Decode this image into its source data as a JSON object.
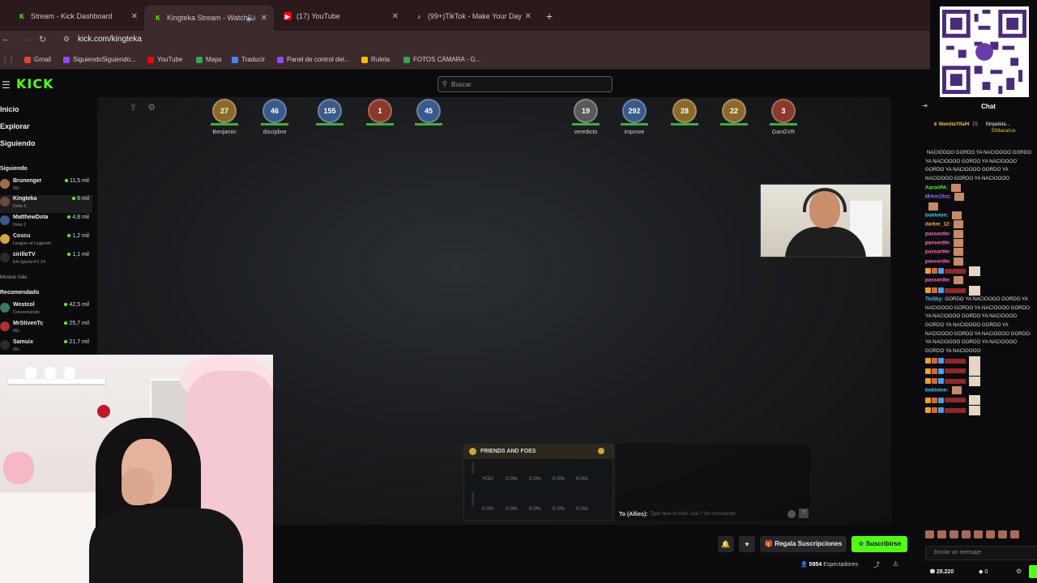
{
  "browser": {
    "tabs": [
      {
        "title": "Stream - Kick Dashboard",
        "favicon": "kick-icon",
        "color": "#53fc18"
      },
      {
        "title": "Kingteka Stream - Watch Li",
        "favicon": "kick-icon",
        "color": "#53fc18",
        "active": true
      },
      {
        "title": "(17) YouTube",
        "favicon": "youtube-icon",
        "color": "#ff0000"
      },
      {
        "title": "(99+)TikTok - Make Your Day",
        "favicon": "tiktok-icon",
        "color": "#ffffff"
      }
    ],
    "url": "kick.com/kingteka",
    "bookmarks": [
      {
        "label": "Gmail",
        "color": "#ea4335"
      },
      {
        "label": "SiguiendoSiguiendo...",
        "color": "#9146ff"
      },
      {
        "label": "YouTube",
        "color": "#ff0000"
      },
      {
        "label": "Maps",
        "color": "#34a853"
      },
      {
        "label": "Traducir",
        "color": "#4285f4"
      },
      {
        "label": "Panel de control del...",
        "color": "#9146ff"
      },
      {
        "label": "Ruleta",
        "color": "#fbbc05"
      },
      {
        "label": "FOTOS CÁMARA - G...",
        "color": "#34a853"
      }
    ]
  },
  "header": {
    "logo": "KICK",
    "search_placeholder": "Buscar"
  },
  "sidebar": {
    "nav": [
      "Inicio",
      "Explorar",
      "Siguiendo"
    ],
    "following_title": "Siguiendo",
    "following": [
      {
        "name": "Brunenger",
        "category": "IRL",
        "viewers": "11,5 mil",
        "color": "#a06b4a"
      },
      {
        "name": "Kingteka",
        "category": "Dota 2",
        "viewers": "6 mil",
        "color": "#6b4a3a",
        "selected": true
      },
      {
        "name": "MatthewDota",
        "category": "Dota 2",
        "viewers": "4,8 mil",
        "color": "#3a5a8a"
      },
      {
        "name": "Coscu",
        "category": "League of Legends",
        "viewers": "1,2 mil",
        "color": "#d4a64a"
      },
      {
        "name": "cirilloTV",
        "category": "EA Sports F1 24",
        "viewers": "1,1 mil",
        "color": "#2a2a2a"
      }
    ],
    "show_more": "Mostrar más",
    "recommended_title": "Recomendado",
    "recommended": [
      {
        "name": "Westcol",
        "category": "Conversando",
        "viewers": "42,5 mil",
        "color": "#3a7a5a"
      },
      {
        "name": "MrStivenTc",
        "category": "IRL",
        "viewers": "25,7 mil",
        "color": "#b03030"
      },
      {
        "name": "Samuix",
        "category": "IRL",
        "viewers": "21,7 mil",
        "color": "#2a2a2a"
      }
    ]
  },
  "game": {
    "radiant": [
      {
        "level": "27",
        "player": "Benjamin",
        "color": "#8a6a2a"
      },
      {
        "level": "46",
        "player": "discipline",
        "color": "#3a5a8a"
      },
      {
        "level": "155",
        "player": "",
        "color": "#3a5a8a"
      },
      {
        "level": "1",
        "player": "",
        "color": "#8a3a2a"
      },
      {
        "level": "45",
        "player": "",
        "color": "#3a5a8a"
      }
    ],
    "dire": [
      {
        "level": "19",
        "player": "veredicto",
        "color": "#5a5a5a"
      },
      {
        "level": "292",
        "player": "improve",
        "color": "#3a5a8a"
      },
      {
        "level": "28",
        "player": "",
        "color": "#8a6a2a"
      },
      {
        "level": "22",
        "player": "",
        "color": "#8a6a2a"
      },
      {
        "level": "3",
        "player": "GanGVR",
        "color": "#8a3a2a"
      }
    ],
    "friends_foes": {
      "title": "FRIENDS AND FOES",
      "allies_label": "ALLIES",
      "enemies_label": "ENEMIES",
      "you_label": "YOU",
      "allies_values": [
        "0.0%",
        "0.0%",
        "0.0%",
        "0.0%"
      ],
      "enemies_values": [
        "0.0%",
        "0.0%",
        "0.0%",
        "0.0%",
        "0.0%"
      ]
    },
    "ally_chat": {
      "label": "To (Allies):",
      "placeholder": "Type here to chat. Use '/' for commands."
    }
  },
  "player_controls": {
    "gift_label": "Regala Suscripciones",
    "subscribe_label": "Suscribirse",
    "viewers_count": "5954",
    "viewers_label": "Espectadores"
  },
  "chat": {
    "title": "Chat",
    "pinned": [
      {
        "user": "MamitaYifalH",
        "amount": "25"
      },
      {
        "user": "Ninjadela...",
        "amount": ""
      },
      {
        "user": "ElMacarius",
        "amount": ""
      }
    ],
    "messages": [
      {
        "user": "",
        "text": "NACIOOOO GORDO YA NACIOOOO GORDO YA NACIOOOO GORDO YA NACIOOOO GORDO YA NACIOOOO GORDO YA NACIOOOO GORDO YA NACIOOOO",
        "color": "#ffffff",
        "emotes": 0
      },
      {
        "user": "AaronPA:",
        "text": "",
        "color": "#53fc18",
        "emotes": 1
      },
      {
        "user": "Mrkm10xz:",
        "text": "",
        "color": "#a070ff",
        "emotes": 1
      },
      {
        "user": "",
        "text": "",
        "color": "#ff4040",
        "emotes": 1
      },
      {
        "user": "bobloton:",
        "text": "",
        "color": "#40d0ff",
        "emotes": 1
      },
      {
        "user": "darker_12:",
        "text": "",
        "color": "#ffb040",
        "emotes": 1
      },
      {
        "user": "passordie:",
        "text": "",
        "color": "#ff70c0",
        "emotes": 1
      },
      {
        "user": "passordie:",
        "text": "",
        "color": "#ff70c0",
        "emotes": 1
      },
      {
        "user": "passordie:",
        "text": "",
        "color": "#ff70c0",
        "emotes": 1
      },
      {
        "user": "passordie:",
        "text": "",
        "color": "#ff70c0",
        "emotes": 1
      },
      {
        "user": "",
        "text": "",
        "color": "#ff4040",
        "emotes": 2
      },
      {
        "user": "passordie:",
        "text": "",
        "color": "#ff70c0",
        "emotes": 1
      },
      {
        "user": "",
        "text": "",
        "color": "#ff4040",
        "emotes": 2
      },
      {
        "user": "TioSky:",
        "text": "GORDO YA NACIOOOO GORDO YA NACIOOOO GORDO YA NACIOOOO GORDO YA NACIOOOO GORDO YA NACIOOOO GORDO YA NACIOOOO GORDO YA NACIOOOO GORDO YA NACIOOOO GORDO YA NACIOOOO GORDO YA NACIOOOO GORDO YA NACIOOOO",
        "color": "#40d0ff",
        "emotes": 0
      },
      {
        "user": "",
        "text": "",
        "color": "#ff4040",
        "emotes": 2
      },
      {
        "user": "",
        "text": "",
        "color": "#ff4040",
        "emotes": 2
      },
      {
        "user": "",
        "text": "",
        "color": "#ff4040",
        "emotes": 2
      },
      {
        "user": "bobloton:",
        "text": "",
        "color": "#40d0ff",
        "emotes": 1
      },
      {
        "user": "",
        "text": "",
        "color": "#ff4040",
        "emotes": 2
      },
      {
        "user": "",
        "text": "",
        "color": "#ff4040",
        "emotes": 2
      }
    ],
    "input_placeholder": "Enviar un mensaje",
    "points": "28.220",
    "zero": "0"
  }
}
